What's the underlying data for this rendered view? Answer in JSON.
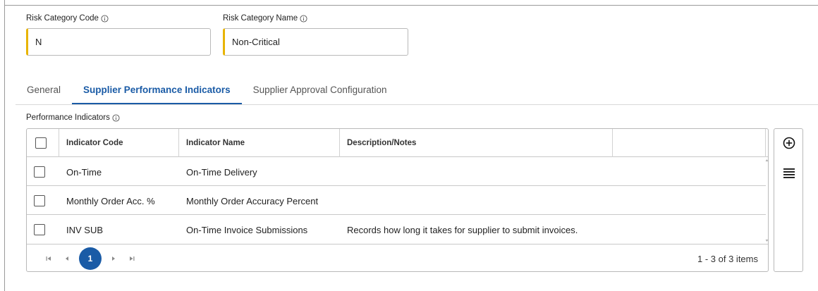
{
  "form": {
    "risk_code": {
      "label": "Risk Category Code",
      "value": "N"
    },
    "risk_name": {
      "label": "Risk Category Name",
      "value": "Non-Critical"
    }
  },
  "tabs": [
    {
      "label": "General",
      "active": false
    },
    {
      "label": "Supplier Performance Indicators",
      "active": true
    },
    {
      "label": "Supplier Approval Configuration",
      "active": false
    }
  ],
  "section": {
    "title": "Performance Indicators"
  },
  "grid": {
    "columns": [
      "Indicator Code",
      "Indicator Name",
      "Description/Notes",
      ""
    ],
    "rows": [
      {
        "code": "On-Time",
        "name": "On-Time Delivery",
        "notes": ""
      },
      {
        "code": "Monthly Order Acc. %",
        "name": "Monthly Order Accuracy Percent",
        "notes": ""
      },
      {
        "code": "INV SUB",
        "name": "On-Time Invoice Submissions",
        "notes": "Records how long it takes for supplier to submit invoices."
      }
    ]
  },
  "pager": {
    "current_page": "1",
    "summary": "1 - 3 of 3 items"
  },
  "icons": {
    "add": "add-circle-icon",
    "menu": "column-menu-icon",
    "info": "info-icon"
  },
  "colors": {
    "accent": "#1a5ba6",
    "required_marker": "#e8b400"
  }
}
